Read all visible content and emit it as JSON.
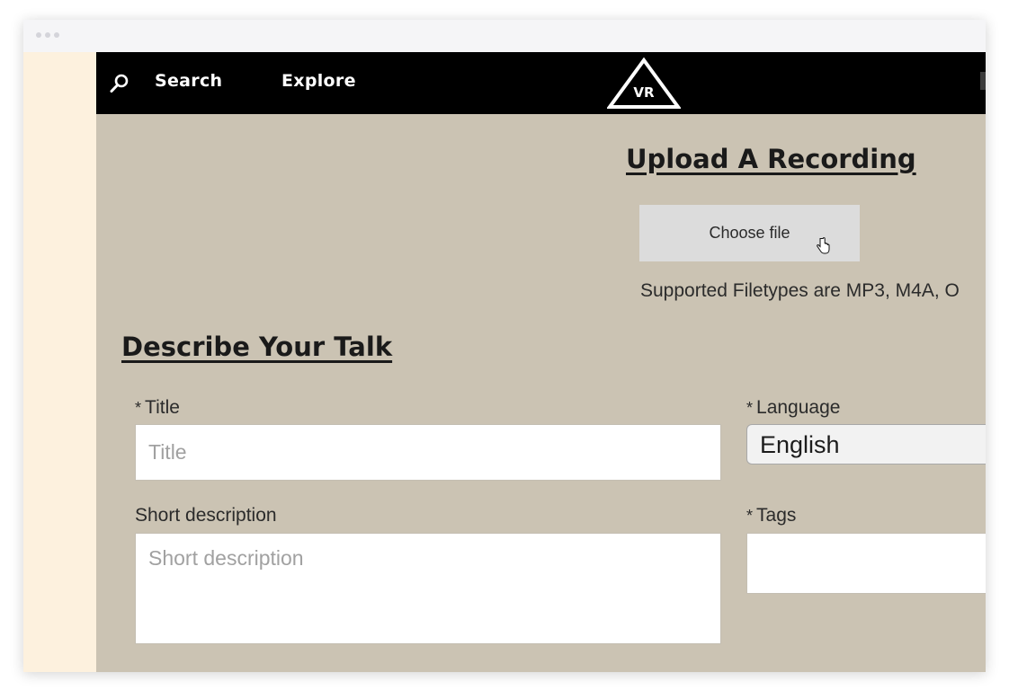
{
  "nav": {
    "search_label": "Search",
    "explore_label": "Explore",
    "logo_text": "VR",
    "icons": {
      "search": "search-icon",
      "logo": "vr-triangle-logo"
    }
  },
  "upload": {
    "heading": "Upload A Recording",
    "choose_file_label": "Choose file",
    "filetypes_text": "Supported Filetypes are MP3, M4A, O"
  },
  "describe": {
    "heading": "Describe Your Talk",
    "title": {
      "required_mark": "*",
      "label": "Title",
      "placeholder": "Title",
      "value": ""
    },
    "language": {
      "required_mark": "*",
      "label": "Language",
      "selected": "English"
    },
    "short_description": {
      "label": "Short description",
      "placeholder": "Short description",
      "value": ""
    },
    "tags": {
      "required_mark": "*",
      "label": "Tags",
      "value": ""
    }
  },
  "colors": {
    "page_background": "#cbc3b3",
    "navbar_background": "#000000",
    "left_strip": "#fdf1de",
    "button_background": "#dcdcdc"
  }
}
